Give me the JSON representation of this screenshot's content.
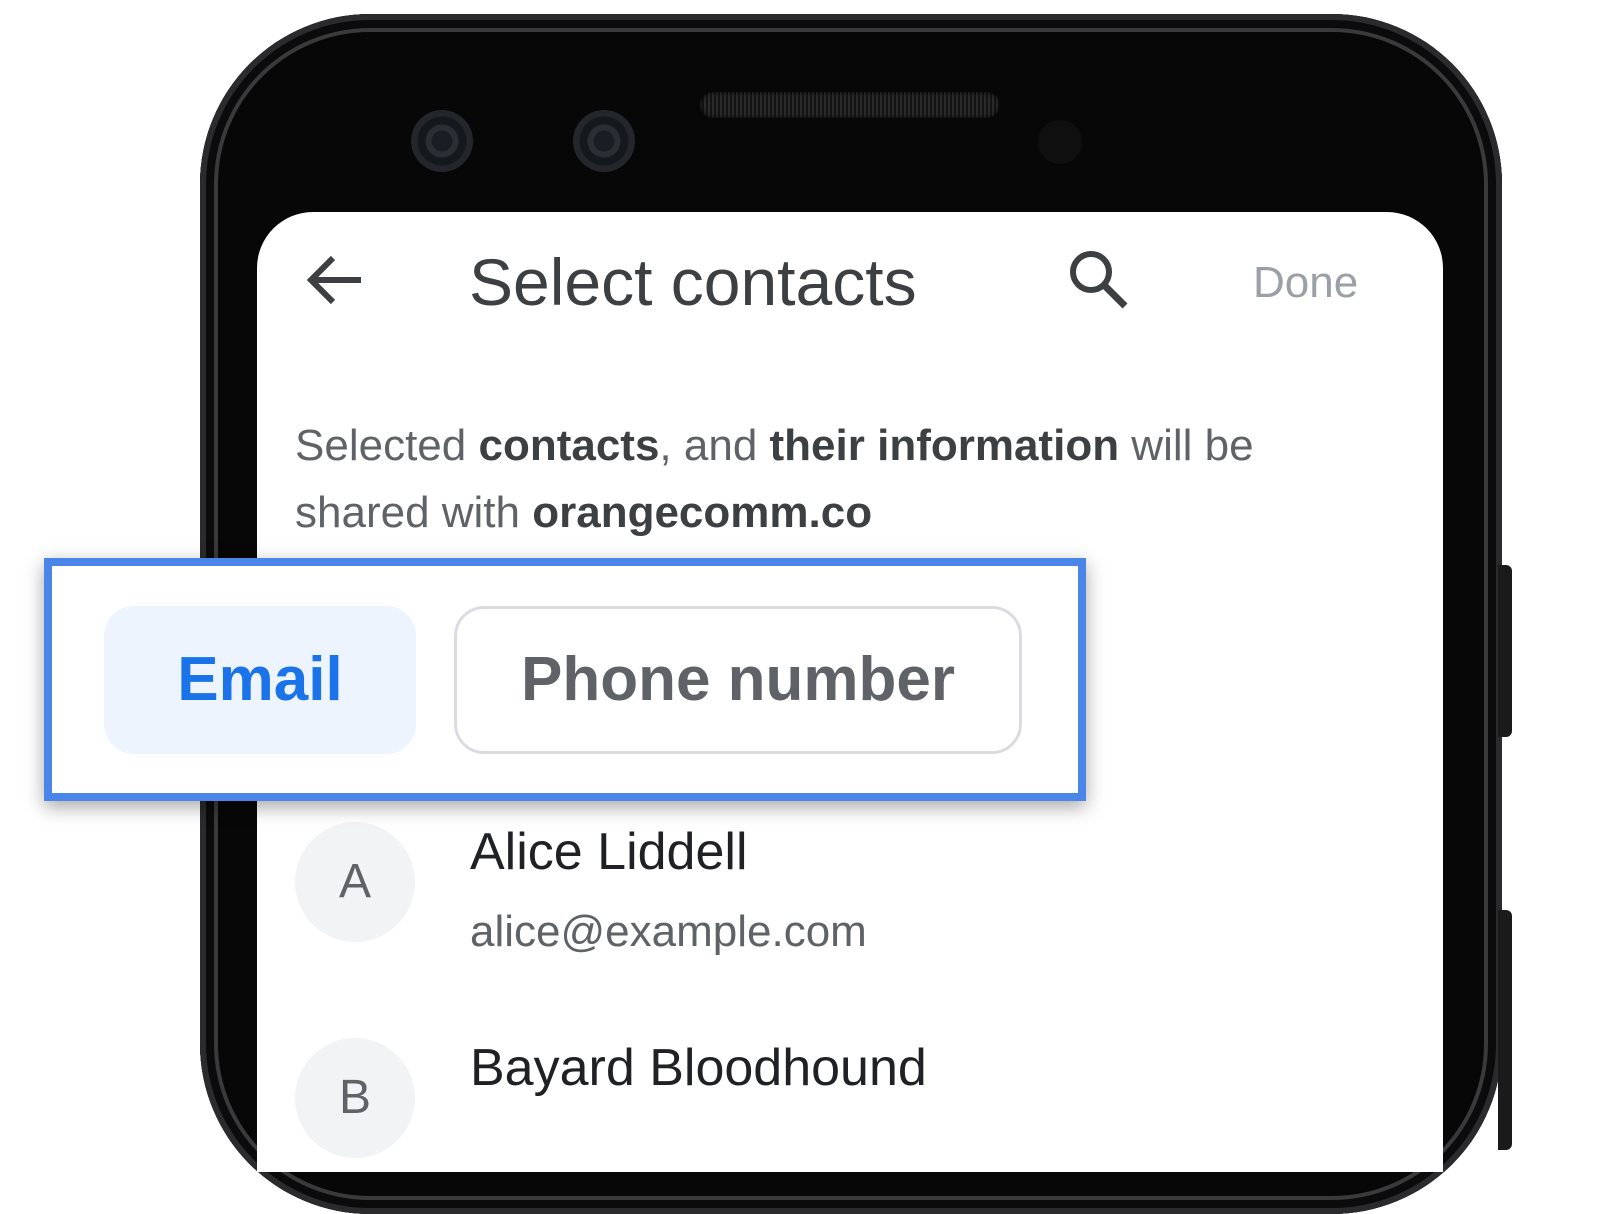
{
  "header": {
    "title": "Select contacts",
    "done_label": "Done",
    "back_icon": "arrow-back-icon",
    "search_icon": "search-icon"
  },
  "notice": {
    "part1": "Selected ",
    "bold1": "contacts",
    "part2": ", and ",
    "bold2": "their information",
    "part3": " will be shared with ",
    "bold3": "orangecomm.co"
  },
  "filter_chips": [
    {
      "label": "Email",
      "selected": true
    },
    {
      "label": "Phone number",
      "selected": false
    }
  ],
  "contacts": [
    {
      "initial": "A",
      "name": "Alice Liddell",
      "email": "alice@example.com"
    },
    {
      "initial": "B",
      "name": "Bayard Bloodhound"
    }
  ],
  "colors": {
    "accent": "#1a73e8",
    "highlight_border": "#4a86e8",
    "chip_selected_bg": "#eef4fd"
  }
}
